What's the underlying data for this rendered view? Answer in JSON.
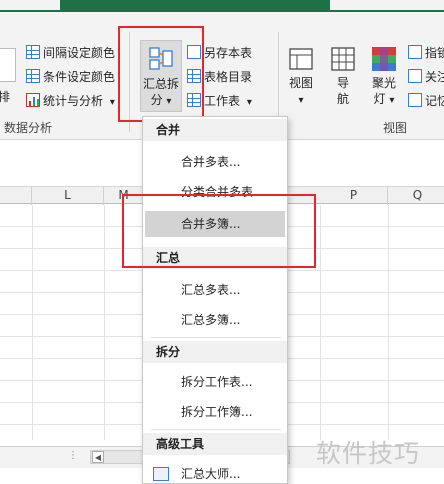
{
  "ribbon": {
    "left_partial": {
      "row1": "间隔设定颜色",
      "row2": "条件设定颜色",
      "row3": "统计与分析",
      "row3_arrow": "▾",
      "side_label": "排",
      "group_label": "数据分析"
    },
    "split_button": {
      "line1": "汇总拆",
      "line2": "分",
      "arrow": "▾"
    },
    "small_buttons": {
      "save_as": "另存本表",
      "sheet_dir": "表格目录",
      "worksheet": "工作表",
      "worksheet_arrow": "▾"
    },
    "view_group": {
      "view_label": "视图",
      "view_arrow": "▾",
      "nav_line1": "导",
      "nav_line2": "航",
      "spotlight_line1": "聚光",
      "spotlight_line2": "灯",
      "spotlight_arrow": "▾",
      "right1": "指锁",
      "right2": "关注",
      "right3": "记忆",
      "group_label": "视图"
    }
  },
  "columns": [
    "L",
    "M",
    "P",
    "Q"
  ],
  "menu": {
    "sections": [
      {
        "header": "合并",
        "items": [
          "合并多表...",
          "分类合并多表...",
          "合并多簿..."
        ]
      },
      {
        "header": "汇总",
        "items": [
          "汇总多表...",
          "汇总多簿..."
        ]
      },
      {
        "header": "拆分",
        "items": [
          "拆分工作表...",
          "拆分工作簿..."
        ]
      },
      {
        "header": "高级工具",
        "items": [
          "汇总大师..."
        ]
      }
    ],
    "highlighted_item": "合并多簿..."
  },
  "watermark": "软件技巧",
  "colors": {
    "accent_green": "#1e7145",
    "highlight_red": "#e0282e",
    "menu_highlight": "#d3d3d3"
  }
}
